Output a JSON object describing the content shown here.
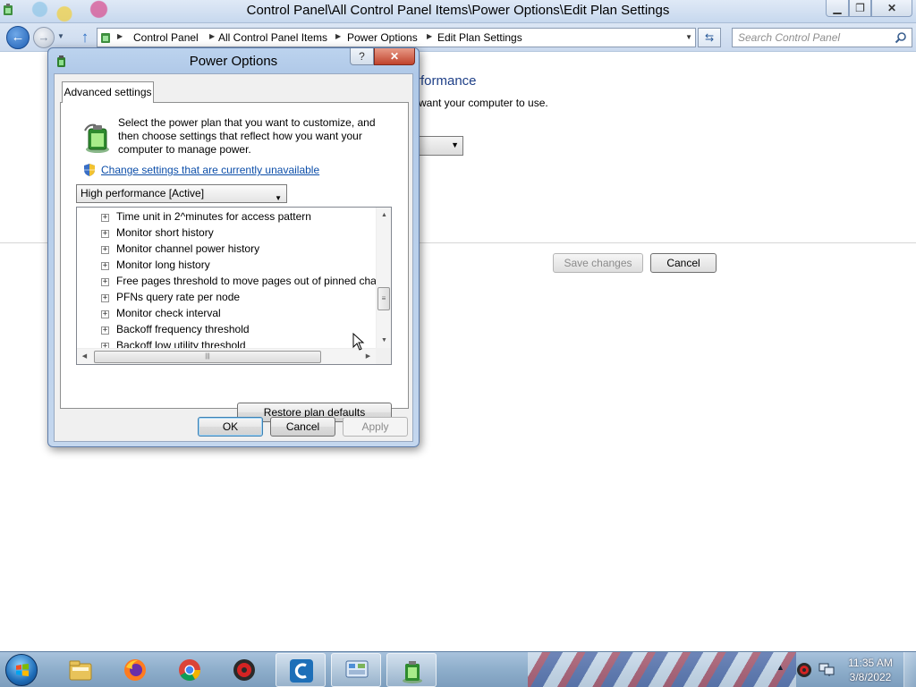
{
  "window": {
    "title": "Control Panel\\All Control Panel Items\\Power Options\\Edit Plan Settings",
    "caption_buttons": {
      "minimize": "▁",
      "maximize": "❐",
      "close": "✕"
    }
  },
  "navbar": {
    "breadcrumbs": [
      "Control Panel",
      "All Control Panel Items",
      "Power Options",
      "Edit Plan Settings"
    ],
    "search_placeholder": "Search Control Panel"
  },
  "background_page": {
    "heading_fragment": "rformance",
    "sub_fragment": "want your computer to use.",
    "save_changes_label": "Save changes",
    "cancel_label": "Cancel"
  },
  "dialog": {
    "title": "Power Options",
    "help_label": "?",
    "close_label": "✕",
    "tab_label": "Advanced settings",
    "intro_text": "Select the power plan that you want to customize, and then choose settings that reflect how you want your computer to manage power.",
    "change_link": "Change settings that are currently unavailable",
    "plan_selected": "High performance [Active]",
    "tree_items": [
      "Time unit in 2^minutes for access pattern",
      "Monitor short history",
      "Monitor channel power history",
      "Monitor long history",
      "Free pages threshold to move pages out of pinned channel",
      "PFNs query rate per node",
      "Monitor check interval",
      "Backoff frequency threshold",
      "Backoff low utility threshold"
    ],
    "expander_glyph": "+",
    "restore_label": "Restore plan defaults",
    "ok_label": "OK",
    "cancel_label": "Cancel",
    "apply_label": "Apply"
  },
  "taskbar": {
    "apps": [
      "windows-explorer-icon",
      "firefox-icon",
      "chrome-icon",
      "antivirus-icon",
      "ccleaner-icon",
      "control-panel-icon",
      "power-options-icon"
    ],
    "clock_time": "11:35 AM",
    "clock_date": "3/8/2022"
  },
  "colors": {
    "link": "#0c4ea9",
    "heading_blue": "#1e3f87",
    "titlebar": "#c7d8ee",
    "taskbar": "#8eaecb"
  }
}
